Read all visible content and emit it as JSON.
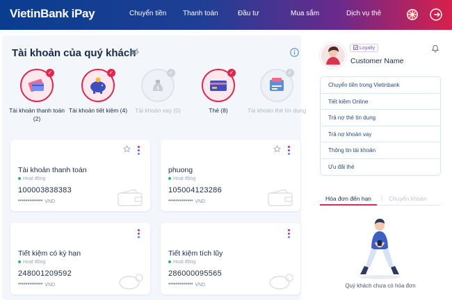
{
  "header": {
    "logo_main": "VietinBank",
    "logo_sub": "iPay",
    "nav": [
      "Chuyển tiền",
      "Thanh toán",
      "Đầu tư",
      "Mua sắm",
      "Dịch vụ thẻ"
    ]
  },
  "main": {
    "title": "Tài khoản của quý khách",
    "account_types": [
      {
        "label": "Tài khoản thanh toán (2)",
        "icon": "wallet-card-icon",
        "active": true
      },
      {
        "label": "Tài khoản tiết kiệm (4)",
        "icon": "piggy-bank-icon",
        "active": true
      },
      {
        "label": "Tài khoản vay (0)",
        "icon": "loan-bag-icon",
        "active": false
      },
      {
        "label": "Thẻ (8)",
        "icon": "credit-card-icon",
        "active": true
      },
      {
        "label": "Tài khoản thẻ tín dụng",
        "icon": "credit-account-icon",
        "active": false
      }
    ],
    "cards": [
      {
        "name": "Tài khoản thanh toán",
        "status": "Hoạt động",
        "number": "100003838383",
        "balance": "*************",
        "currency": "VND"
      },
      {
        "name": "phuong",
        "status": "Hoạt động",
        "number": "105004123286",
        "balance": "*************",
        "currency": "VND"
      },
      {
        "name": "Tiết kiệm có kỳ hạn",
        "status": "Hoạt động",
        "number": "248001209592",
        "balance": "*************",
        "currency": "VND"
      },
      {
        "name": "Tiết kiệm tích lũy",
        "status": "Hoạt động",
        "number": "286000095565",
        "balance": "*************",
        "currency": "VND"
      }
    ]
  },
  "side": {
    "loyalty": "Loyalty",
    "customer_name": "Customer Name",
    "menu": [
      "Chuyển tiền trong Vietinbank",
      "Tiết kiệm Online",
      "Trả nợ thẻ tín dụng",
      "Trả nợ khoản vay",
      "Thông tin tài khoản",
      "Ưu đãi thẻ"
    ],
    "tab_active": "Hóa đơn đến hạn",
    "tab_separator": "|",
    "tab_inactive": "Chuyển khoản",
    "empty_message": "Quý khách chưa có hóa đơn"
  },
  "colors": {
    "accent": "#e0284f",
    "navy": "#1a2b49",
    "header_start": "#0a3d8f",
    "header_end": "#d8204a"
  }
}
